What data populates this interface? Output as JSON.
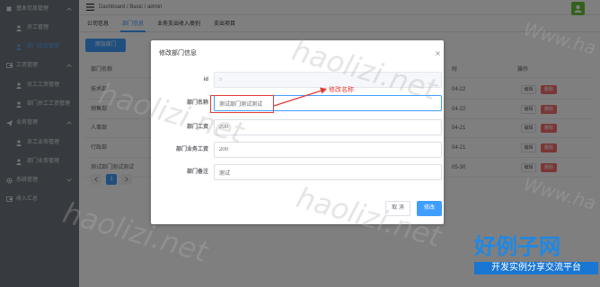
{
  "sidebar": {
    "items": [
      {
        "label": "基本信息管理",
        "icon": "square-icon",
        "kind": "group",
        "expanded": true
      },
      {
        "label": "员工管理",
        "icon": "user-icon",
        "kind": "sub"
      },
      {
        "label": "部门信息管理",
        "icon": "user-icon",
        "kind": "sub",
        "active": true
      },
      {
        "label": "工资管理",
        "icon": "wallet-icon",
        "kind": "group",
        "expanded": true
      },
      {
        "label": "员工工资管理",
        "icon": "user-icon",
        "kind": "sub"
      },
      {
        "label": "部门员工工资管理",
        "icon": "user-icon",
        "kind": "sub"
      },
      {
        "label": "业务管理",
        "icon": "plane-icon",
        "kind": "group",
        "expanded": true
      },
      {
        "label": "员工业务管理",
        "icon": "user-icon",
        "kind": "sub"
      },
      {
        "label": "部门业务管理",
        "icon": "user-icon",
        "kind": "sub"
      },
      {
        "label": "系统管理",
        "icon": "gear-icon",
        "kind": "group",
        "expanded": false
      },
      {
        "label": "收入汇总",
        "icon": "wallet-icon",
        "kind": "group"
      }
    ]
  },
  "header": {
    "breadcrumb": "Dashboard / Basic / admin",
    "menu_icon": "hamburger-icon",
    "avatar_icon": "user-avatar-icon"
  },
  "tabs": [
    {
      "label": "公司信息"
    },
    {
      "label": "部门信息",
      "active": true
    },
    {
      "label": "业务支出收入类别"
    },
    {
      "label": "支出项目"
    }
  ],
  "toolbar": {
    "add_label": "添加部门"
  },
  "table": {
    "headers": {
      "name": "部门名称",
      "time": "时",
      "actions": "操作"
    },
    "rows": [
      {
        "name": "技术部",
        "date": "04-22"
      },
      {
        "name": "销售部",
        "date": "04-22"
      },
      {
        "name": "人事部",
        "date": "04-21"
      },
      {
        "name": "行政部",
        "date": "04-21"
      },
      {
        "name": "测试部门测试测试",
        "date": "05-30"
      }
    ],
    "edit_label": "编辑",
    "delete_label": "删除"
  },
  "pagination": {
    "current_page": "1"
  },
  "modal": {
    "title": "修改部门信息",
    "fields": [
      {
        "label": "id",
        "value": "5",
        "disabled": true
      },
      {
        "label": "部门名称",
        "value": "测试部门测试测试",
        "focused": true
      },
      {
        "label": "部门工资",
        "value": "200"
      },
      {
        "label": "部门业务工资",
        "value": "200"
      },
      {
        "label": "部门备注",
        "value": "测试"
      }
    ],
    "cancel_label": "取 消",
    "submit_label": "修改"
  },
  "annotation": {
    "text": "修改名称"
  },
  "watermark": {
    "text": "haolizi.net",
    "partial": "Www.ha"
  },
  "logo": {
    "title": "好例子网",
    "subtitle": "开发实例分享交流平台"
  },
  "colors": {
    "accent": "#409eff",
    "danger": "#f56c6c",
    "annotation": "#e53935",
    "avatar": "#67c23a",
    "logo": "#1e88e5"
  }
}
